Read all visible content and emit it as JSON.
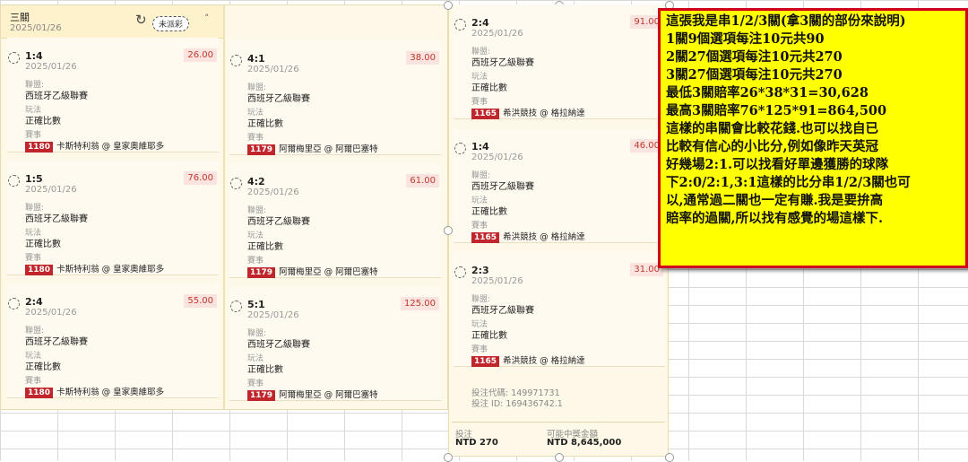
{
  "panel": {
    "title": "三關",
    "date": "2025/01/26",
    "status_badge": "未派彩",
    "refresh_icon": "refresh-icon",
    "collapse_icon": "caret-up-icon"
  },
  "labels": {
    "league": "聯盟:",
    "play": "玩法",
    "event": "賽事"
  },
  "columns": [
    {
      "cards": [
        {
          "score": "1:4",
          "date": "2025/01/26",
          "odds": "26.00",
          "league": "西班牙乙級聯賽",
          "play": "正確比數",
          "event_id": "1180",
          "event": "卡斯特利翁 @ 皇家奧維耶多"
        },
        {
          "score": "1:5",
          "date": "2025/01/26",
          "odds": "76.00",
          "league": "西班牙乙級聯賽",
          "play": "正確比數",
          "event_id": "1180",
          "event": "卡斯特利翁 @ 皇家奧維耶多"
        },
        {
          "score": "2:4",
          "date": "2025/01/26",
          "odds": "55.00",
          "league": "西班牙乙級聯賽",
          "play": "正確比數",
          "event_id": "1180",
          "event": "卡斯特利翁 @ 皇家奧維耶多"
        }
      ]
    },
    {
      "cards": [
        {
          "score": "4:1",
          "date": "2025/01/26",
          "odds": "38.00",
          "league": "西班牙乙級聯賽",
          "play": "正確比數",
          "event_id": "1179",
          "event": "阿爾梅里亞 @ 阿爾巴塞特"
        },
        {
          "score": "4:2",
          "date": "2025/01/26",
          "odds": "61.00",
          "league": "西班牙乙級聯賽",
          "play": "正確比數",
          "event_id": "1179",
          "event": "阿爾梅里亞 @ 阿爾巴塞特"
        },
        {
          "score": "5:1",
          "date": "2025/01/26",
          "odds": "125.00",
          "league": "西班牙乙級聯賽",
          "play": "正確比數",
          "event_id": "1179",
          "event": "阿爾梅里亞 @ 阿爾巴塞特"
        }
      ]
    },
    {
      "cards": [
        {
          "score": "2:4",
          "date": "2025/01/26",
          "odds": "91.00",
          "league": "西班牙乙級聯賽",
          "play": "正確比數",
          "event_id": "1165",
          "event": "希洪競技 @ 格拉納達"
        },
        {
          "score": "1:4",
          "date": "2025/01/26",
          "odds": "46.00",
          "league": "西班牙乙級聯賽",
          "play": "正確比數",
          "event_id": "1165",
          "event": "希洪競技 @ 格拉納達"
        },
        {
          "score": "2:3",
          "date": "2025/01/26",
          "odds": "31.00",
          "league": "西班牙乙級聯賽",
          "play": "正確比數",
          "event_id": "1165",
          "event": "希洪競技 @ 格拉納達"
        }
      ]
    }
  ],
  "bet_info": {
    "code": "投注代碼: 149971731",
    "bet_id": "投注 ID: 169436742.1"
  },
  "totals": {
    "stake_label": "投注",
    "stake_value": "NTD 270",
    "win_label": "可能中獎金額",
    "win_value": "NTD 8,645,000"
  },
  "note": {
    "lines": [
      "這張我是串1/2/3關(拿3關的部份來說明)",
      "1關9個選項每注10元共90",
      "2關27個選項每注10元共270",
      "3關27個選項每注10元共270",
      "最低3關賠率26*38*31=30,628",
      "最高3關賠率76*125*91=864,500",
      "這樣的串關會比較花錢.也可以找自已",
      "比較有信心的小比分,例如像昨天英冠",
      "好幾場2:1.可以找看好單邊獲勝的球隊",
      "下2:0/2:1,3:1這樣的比分串1/2/3關也可",
      "以,通常過二關也一定有賺.我是要拚高",
      "賠率的過關,所以找有感覺的場這樣下."
    ],
    "bg_color": "#ffff00",
    "border_color": "#d0021b"
  }
}
